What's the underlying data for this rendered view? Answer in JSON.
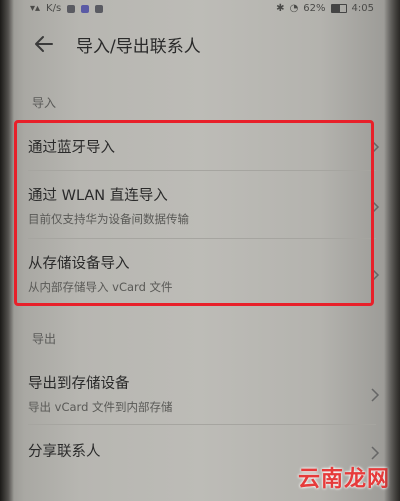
{
  "status_bar": {
    "carrier_hint": "K/s",
    "battery": "62%",
    "battery_level": 0.62,
    "time": "4:05"
  },
  "header": {
    "back_icon": "arrow-left-icon",
    "title": "导入/导出联系人"
  },
  "import_section": {
    "label": "导入",
    "items": [
      {
        "title": "通过蓝牙导入",
        "subtitle": ""
      },
      {
        "title": "通过 WLAN 直连导入",
        "subtitle": "目前仅支持华为设备间数据传输"
      },
      {
        "title": "从存储设备导入",
        "subtitle": "从内部存储导入 vCard 文件"
      }
    ]
  },
  "export_section": {
    "label": "导出",
    "items": [
      {
        "title": "导出到存储设备",
        "subtitle": "导出 vCard 文件到内部存储"
      },
      {
        "title": "分享联系人",
        "subtitle": ""
      }
    ]
  },
  "annotation": {
    "color": "#e8202a"
  },
  "watermark": {
    "text": "云南龙网",
    "color": "#e63b3b"
  }
}
